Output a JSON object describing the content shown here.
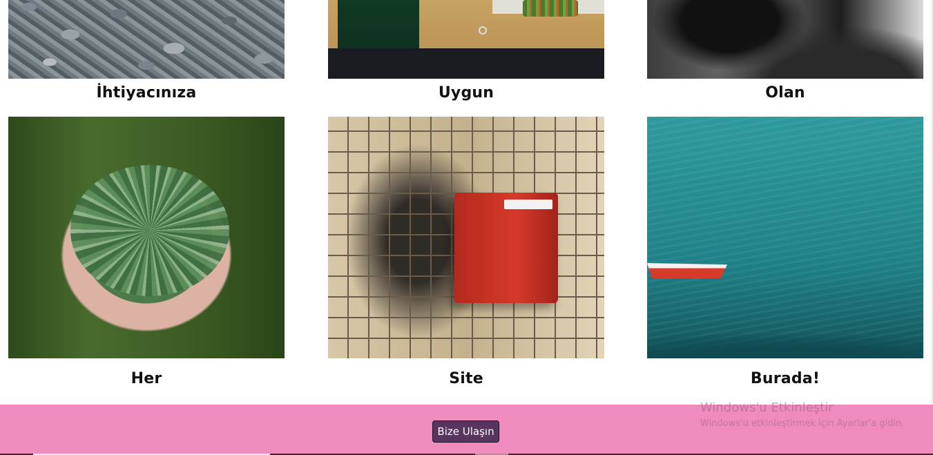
{
  "gallery": {
    "items": [
      {
        "caption": "İhtiyacınıza",
        "image": "pebbles-photo"
      },
      {
        "caption": "Uygun",
        "image": "green-door-building-photo"
      },
      {
        "caption": "Olan",
        "image": "black-white-shoulder-photo"
      },
      {
        "caption": "Her",
        "image": "hands-holding-pine-needles-photo"
      },
      {
        "caption": "Site",
        "image": "red-alarm-box-on-tiled-wall-photo"
      },
      {
        "caption": "Burada!",
        "image": "red-boat-on-turquoise-sea-photo"
      }
    ]
  },
  "footer": {
    "contact_button_label": "Bize Ulaşın",
    "background_color": "#ef8bbd",
    "button_color": "#57355f"
  },
  "windows_activation": {
    "title": "Windows'u Etkinleştir",
    "subtitle": "Windows'u etkinleştirmek için Ayarlar'a gidin."
  }
}
